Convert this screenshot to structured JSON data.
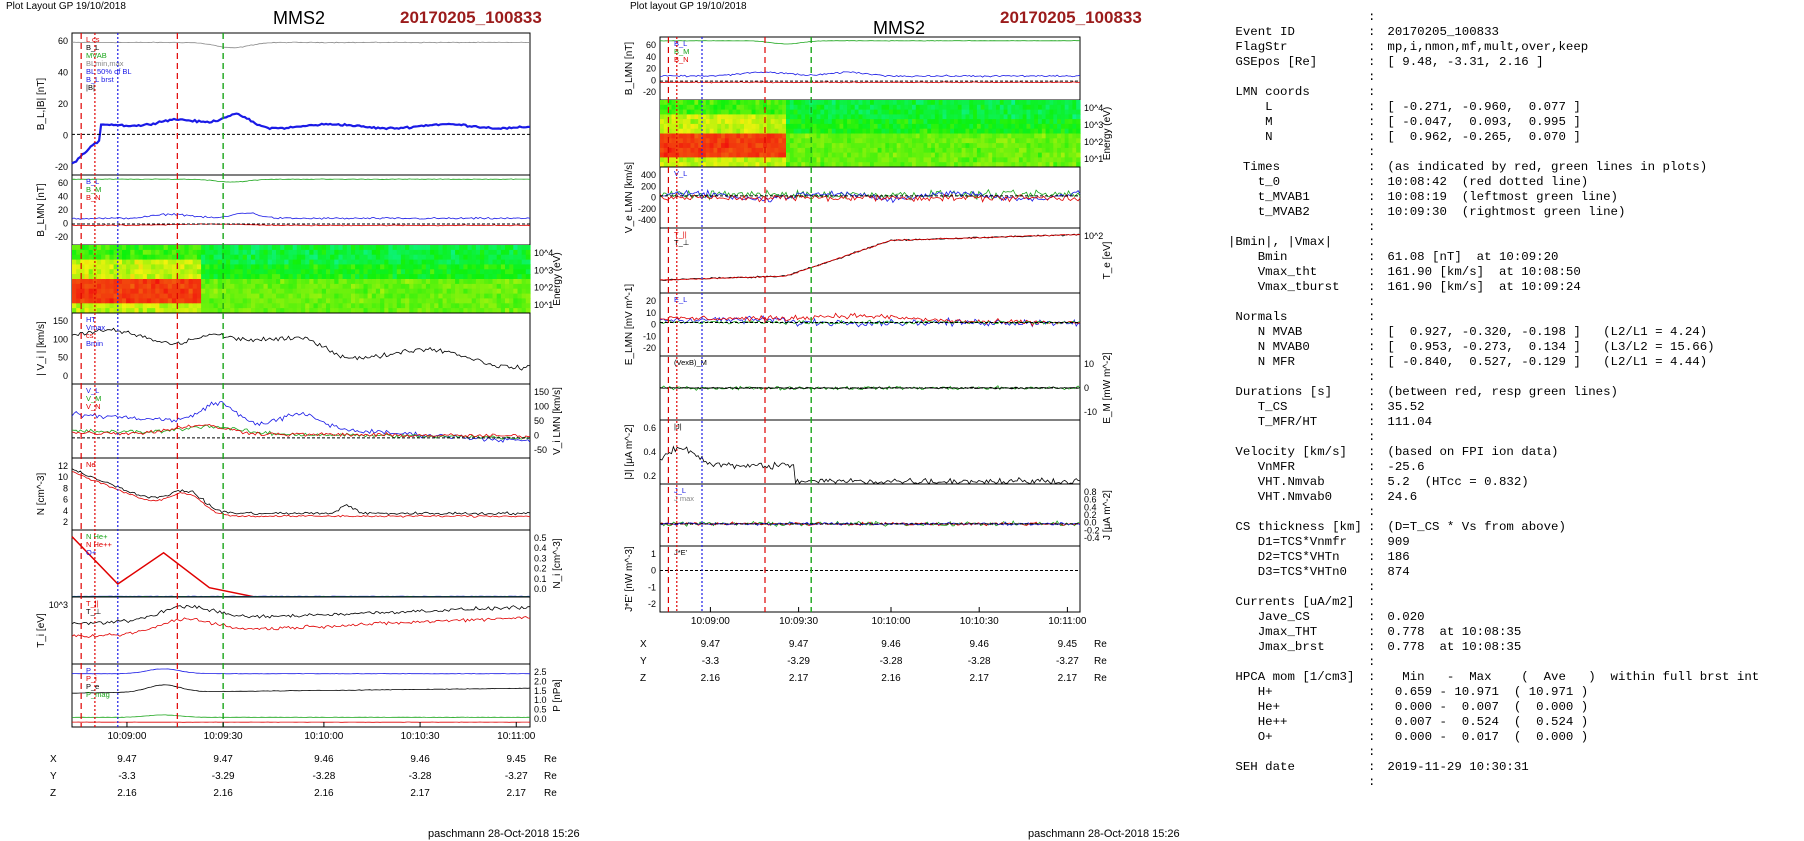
{
  "left": {
    "header": "Plot Layout GP 19/10/2018",
    "spacecraft": "MMS2",
    "event": "20170205_100833",
    "credit": "paschmann 28-Oct-2018 15:26",
    "panels": [
      {
        "ylabel": "B_L,|B| [nT]",
        "ylim": [
          -30,
          75
        ],
        "ticks": [
          "60",
          "40",
          "20",
          "0",
          "-20"
        ],
        "legend": [
          "L cs",
          "B_L",
          "MVAB",
          "BLmin,max",
          "BL 50% of BL",
          "B_L brst",
          "|B|"
        ]
      },
      {
        "ylabel": "B_LMN [nT]",
        "ylim": [
          -30,
          70
        ],
        "ticks": [
          "60",
          "40",
          "20",
          "0",
          "-20"
        ],
        "legend": [
          "B_L",
          "B_M",
          "B_N"
        ]
      },
      {
        "ylabel": "Energy (eV)",
        "ticks": [
          "10^4",
          "10^3",
          "10^2",
          "10^1"
        ]
      },
      {
        "ylabel": "| V_i | [km/s]",
        "ylim": [
          0,
          160
        ],
        "ticks": [
          "150",
          "100",
          "50",
          "0"
        ],
        "legend": [
          "HT",
          "Vmax",
          "cs",
          "Bmin"
        ]
      },
      {
        "ylabel": "V_i LMN [km/s]",
        "ylim": [
          -60,
          160
        ],
        "ticks": [
          "150",
          "100",
          "50",
          "0",
          "-50"
        ],
        "legend": [
          "V_L",
          "V_M",
          "V_N"
        ]
      },
      {
        "ylabel": "N [cm^-3]",
        "ylim": [
          0,
          13
        ],
        "ticks": [
          "12",
          "10",
          "8",
          "6",
          "4",
          "2"
        ],
        "legend": [
          "Ne"
        ]
      },
      {
        "ylabel": "N_i [cm^-3]",
        "ylim": [
          0,
          0.5
        ],
        "ticks": [
          "0.5",
          "0.4",
          "0.3",
          "0.2",
          "0.1",
          "0.0"
        ],
        "legend": [
          "N He+",
          "N He++",
          "O+"
        ]
      },
      {
        "ylabel": "T_i [eV]",
        "ticks": [
          "10^3"
        ],
        "legend": [
          "T_||",
          "T_⊥"
        ]
      },
      {
        "ylabel": "P [nPa]",
        "ylim": [
          0,
          2.6
        ],
        "ticks": [
          "2.5",
          "2.0",
          "1.5",
          "1.0",
          "0.5",
          "0.0"
        ],
        "legend": [
          "P",
          "P_i",
          "P_e",
          "P_mag"
        ]
      }
    ],
    "time_ticks": [
      "10:09:00",
      "10:09:30",
      "10:10:00",
      "10:10:30",
      "10:11:00"
    ],
    "pos": {
      "x_label": "X",
      "y_label": "Y",
      "z_label": "Z",
      "unit": "Re",
      "X": [
        "9.47",
        "9.47",
        "9.46",
        "9.46",
        "9.45"
      ],
      "Y": [
        "-3.3",
        "-3.29",
        "-3.28",
        "-3.28",
        "-3.27"
      ],
      "Z": [
        "2.16",
        "2.16",
        "2.16",
        "2.17",
        "2.17"
      ]
    }
  },
  "middle": {
    "header": "Plot layout GP 19/10/2018",
    "spacecraft": "MMS2",
    "event": "20170205_100833",
    "credit": "paschmann 28-Oct-2018 15:26",
    "panels": [
      {
        "ylabel": "B_LMN [nT]",
        "ylim": [
          -30,
          70
        ],
        "ticks": [
          "60",
          "40",
          "20",
          "0",
          "-20"
        ],
        "legend": [
          "B_L",
          "B_M",
          "B_N"
        ]
      },
      {
        "ylabel": "Energy (eV)",
        "ticks": [
          "10^4",
          "10^3",
          "10^2",
          "10^1"
        ]
      },
      {
        "ylabel": "V_e LMN [km/s]",
        "ylim": [
          -500,
          450
        ],
        "ticks": [
          "400",
          "200",
          "0",
          "-200",
          "-400"
        ],
        "legend": [
          "V_L"
        ]
      },
      {
        "ylabel": "T_e [eV]",
        "ticks": [
          "10^2"
        ],
        "legend": [
          "T_||",
          "T_⊥"
        ]
      },
      {
        "ylabel": "E_LMN [mV m^-1]",
        "ylim": [
          -25,
          22
        ],
        "ticks": [
          "20",
          "10",
          "0",
          "-10",
          "-20"
        ],
        "legend": [
          "E_L"
        ]
      },
      {
        "ylabel": "E_M [mW m^-2]",
        "ylim": [
          -15,
          15
        ],
        "ticks": [
          "10",
          "0",
          "-10"
        ],
        "legend": [
          "(VexB)_M"
        ]
      },
      {
        "ylabel": "|J| [μA m^-2]",
        "ylim": [
          0,
          0.7
        ],
        "ticks": [
          "0.6",
          "0.4",
          "0.2"
        ],
        "legend": [
          "|J|"
        ]
      },
      {
        "ylabel": "J [μA m^-2]",
        "ylim": [
          -0.5,
          0.9
        ],
        "ticks": [
          "0.8",
          "0.6",
          "0.4",
          "0.2",
          "0.0",
          "-0.2",
          "-0.4"
        ],
        "legend": [
          "J_L",
          "J max"
        ]
      },
      {
        "ylabel": "J*E' [nW m^-3]",
        "ylim": [
          -2.2,
          1.3
        ],
        "ticks": [
          "1",
          "0",
          "-1",
          "-2"
        ],
        "legend": [
          "J*E'"
        ]
      }
    ],
    "time_ticks": [
      "10:09:00",
      "10:09:30",
      "10:10:00",
      "10:10:30",
      "10:11:00"
    ],
    "pos": {
      "x_label": "X",
      "y_label": "Y",
      "z_label": "Z",
      "unit": "Re",
      "X": [
        "9.47",
        "9.47",
        "9.46",
        "9.46",
        "9.45"
      ],
      "Y": [
        "-3.3",
        "-3.29",
        "-3.28",
        "-3.28",
        "-3.27"
      ],
      "Z": [
        "2.16",
        "2.17",
        "2.16",
        "2.17",
        "2.17"
      ]
    }
  },
  "info": [
    [
      ":",
      "",
      ""
    ],
    [
      " Event ID",
      ":",
      " 20170205_100833"
    ],
    [
      " FlagStr",
      ":",
      " mp,i,nmon,mf,mult,over,keep"
    ],
    [
      " GSEpos [Re]",
      ":",
      " [ 9.48, -3.31, 2.16 ]"
    ],
    [
      "",
      ":",
      ""
    ],
    [
      " LMN coords",
      ":",
      ""
    ],
    [
      "     L",
      ":",
      " [ -0.271, -0.960,  0.077 ]"
    ],
    [
      "     M",
      ":",
      " [ -0.047,  0.093,  0.995 ]"
    ],
    [
      "     N",
      ":",
      " [  0.962, -0.265,  0.070 ]"
    ],
    [
      "",
      ":",
      ""
    ],
    [
      "  Times",
      ":",
      " (as indicated by red, green lines in plots)"
    ],
    [
      "    t_0",
      ":",
      " 10:08:42  (red dotted line)"
    ],
    [
      "    t_MVAB1",
      ":",
      " 10:08:19  (leftmost green line)"
    ],
    [
      "    t_MVAB2",
      ":",
      " 10:09:30  (rightmost green line)"
    ],
    [
      "",
      ":",
      ""
    ],
    [
      "|Bmin|, |Vmax|",
      ":",
      ""
    ],
    [
      "    Bmin",
      ":",
      " 61.08 [nT]  at 10:09:20"
    ],
    [
      "    Vmax_tht",
      ":",
      " 161.90 [km/s]  at 10:08:50"
    ],
    [
      "    Vmax_tburst",
      ":",
      " 161.90 [km/s]  at 10:09:24"
    ],
    [
      "",
      ":",
      ""
    ],
    [
      " Normals",
      ":",
      ""
    ],
    [
      "    N MVAB",
      ":",
      " [  0.927, -0.320, -0.198 ]   (L2/L1 = 4.24)"
    ],
    [
      "    N MVAB0",
      ":",
      " [  0.953, -0.273,  0.134 ]   (L3/L2 = 15.66)"
    ],
    [
      "    N MFR",
      ":",
      " [ -0.840,  0.527, -0.129 ]   (L2/L1 = 4.44)"
    ],
    [
      "",
      ":",
      ""
    ],
    [
      " Durations [s]",
      ":",
      " (between red, resp green lines)"
    ],
    [
      "    T_CS",
      ":",
      " 35.52"
    ],
    [
      "    T_MFR/HT",
      ":",
      " 111.04"
    ],
    [
      "",
      ":",
      ""
    ],
    [
      " Velocity [km/s]",
      ":",
      " (based on FPI ion data)"
    ],
    [
      "    VnMFR",
      ":",
      " -25.6"
    ],
    [
      "    VHT.Nmvab",
      ":",
      " 5.2  (HTcc = 0.832)"
    ],
    [
      "    VHT.Nmvab0",
      ":",
      " 24.6"
    ],
    [
      "",
      ":",
      ""
    ],
    [
      " CS thickness [km]",
      ":",
      " (D=T_CS * Vs from above)"
    ],
    [
      "    D1=TCS*Vnmfr",
      ":",
      " 909"
    ],
    [
      "    D2=TCS*VHTn",
      ":",
      " 186"
    ],
    [
      "    D3=TCS*VHTn0",
      ":",
      " 874"
    ],
    [
      "",
      ":",
      ""
    ],
    [
      " Currents [uA/m2]",
      ":",
      ""
    ],
    [
      "    Jave_CS",
      ":",
      " 0.020"
    ],
    [
      "    Jmax_THT",
      ":",
      " 0.778  at 10:08:35"
    ],
    [
      "    Jmax_brst",
      ":",
      " 0.778  at 10:08:35"
    ],
    [
      "",
      ":",
      ""
    ],
    [
      " HPCA mom [1/cm3]",
      ":",
      "   Min   -  Max    (  Ave   )  within full brst int"
    ],
    [
      "    H+",
      ":",
      "  0.659 - 10.971  ( 10.971 )"
    ],
    [
      "    He+",
      ":",
      "  0.000 -  0.007  (  0.000 )"
    ],
    [
      "    He++",
      ":",
      "  0.007 -  0.524  (  0.524 )"
    ],
    [
      "    O+",
      ":",
      "  0.000 -  0.017  (  0.000 )"
    ],
    [
      "",
      ":",
      ""
    ],
    [
      " SEH date",
      ":",
      " 2019-11-29 10:30:31"
    ],
    [
      "",
      ":",
      ""
    ]
  ],
  "colors": {
    "event": "#9b1b1b",
    "red": "#e00000",
    "green": "#1aa51a",
    "blue": "#1a1ae6",
    "black": "#000000",
    "gray": "#888888"
  }
}
